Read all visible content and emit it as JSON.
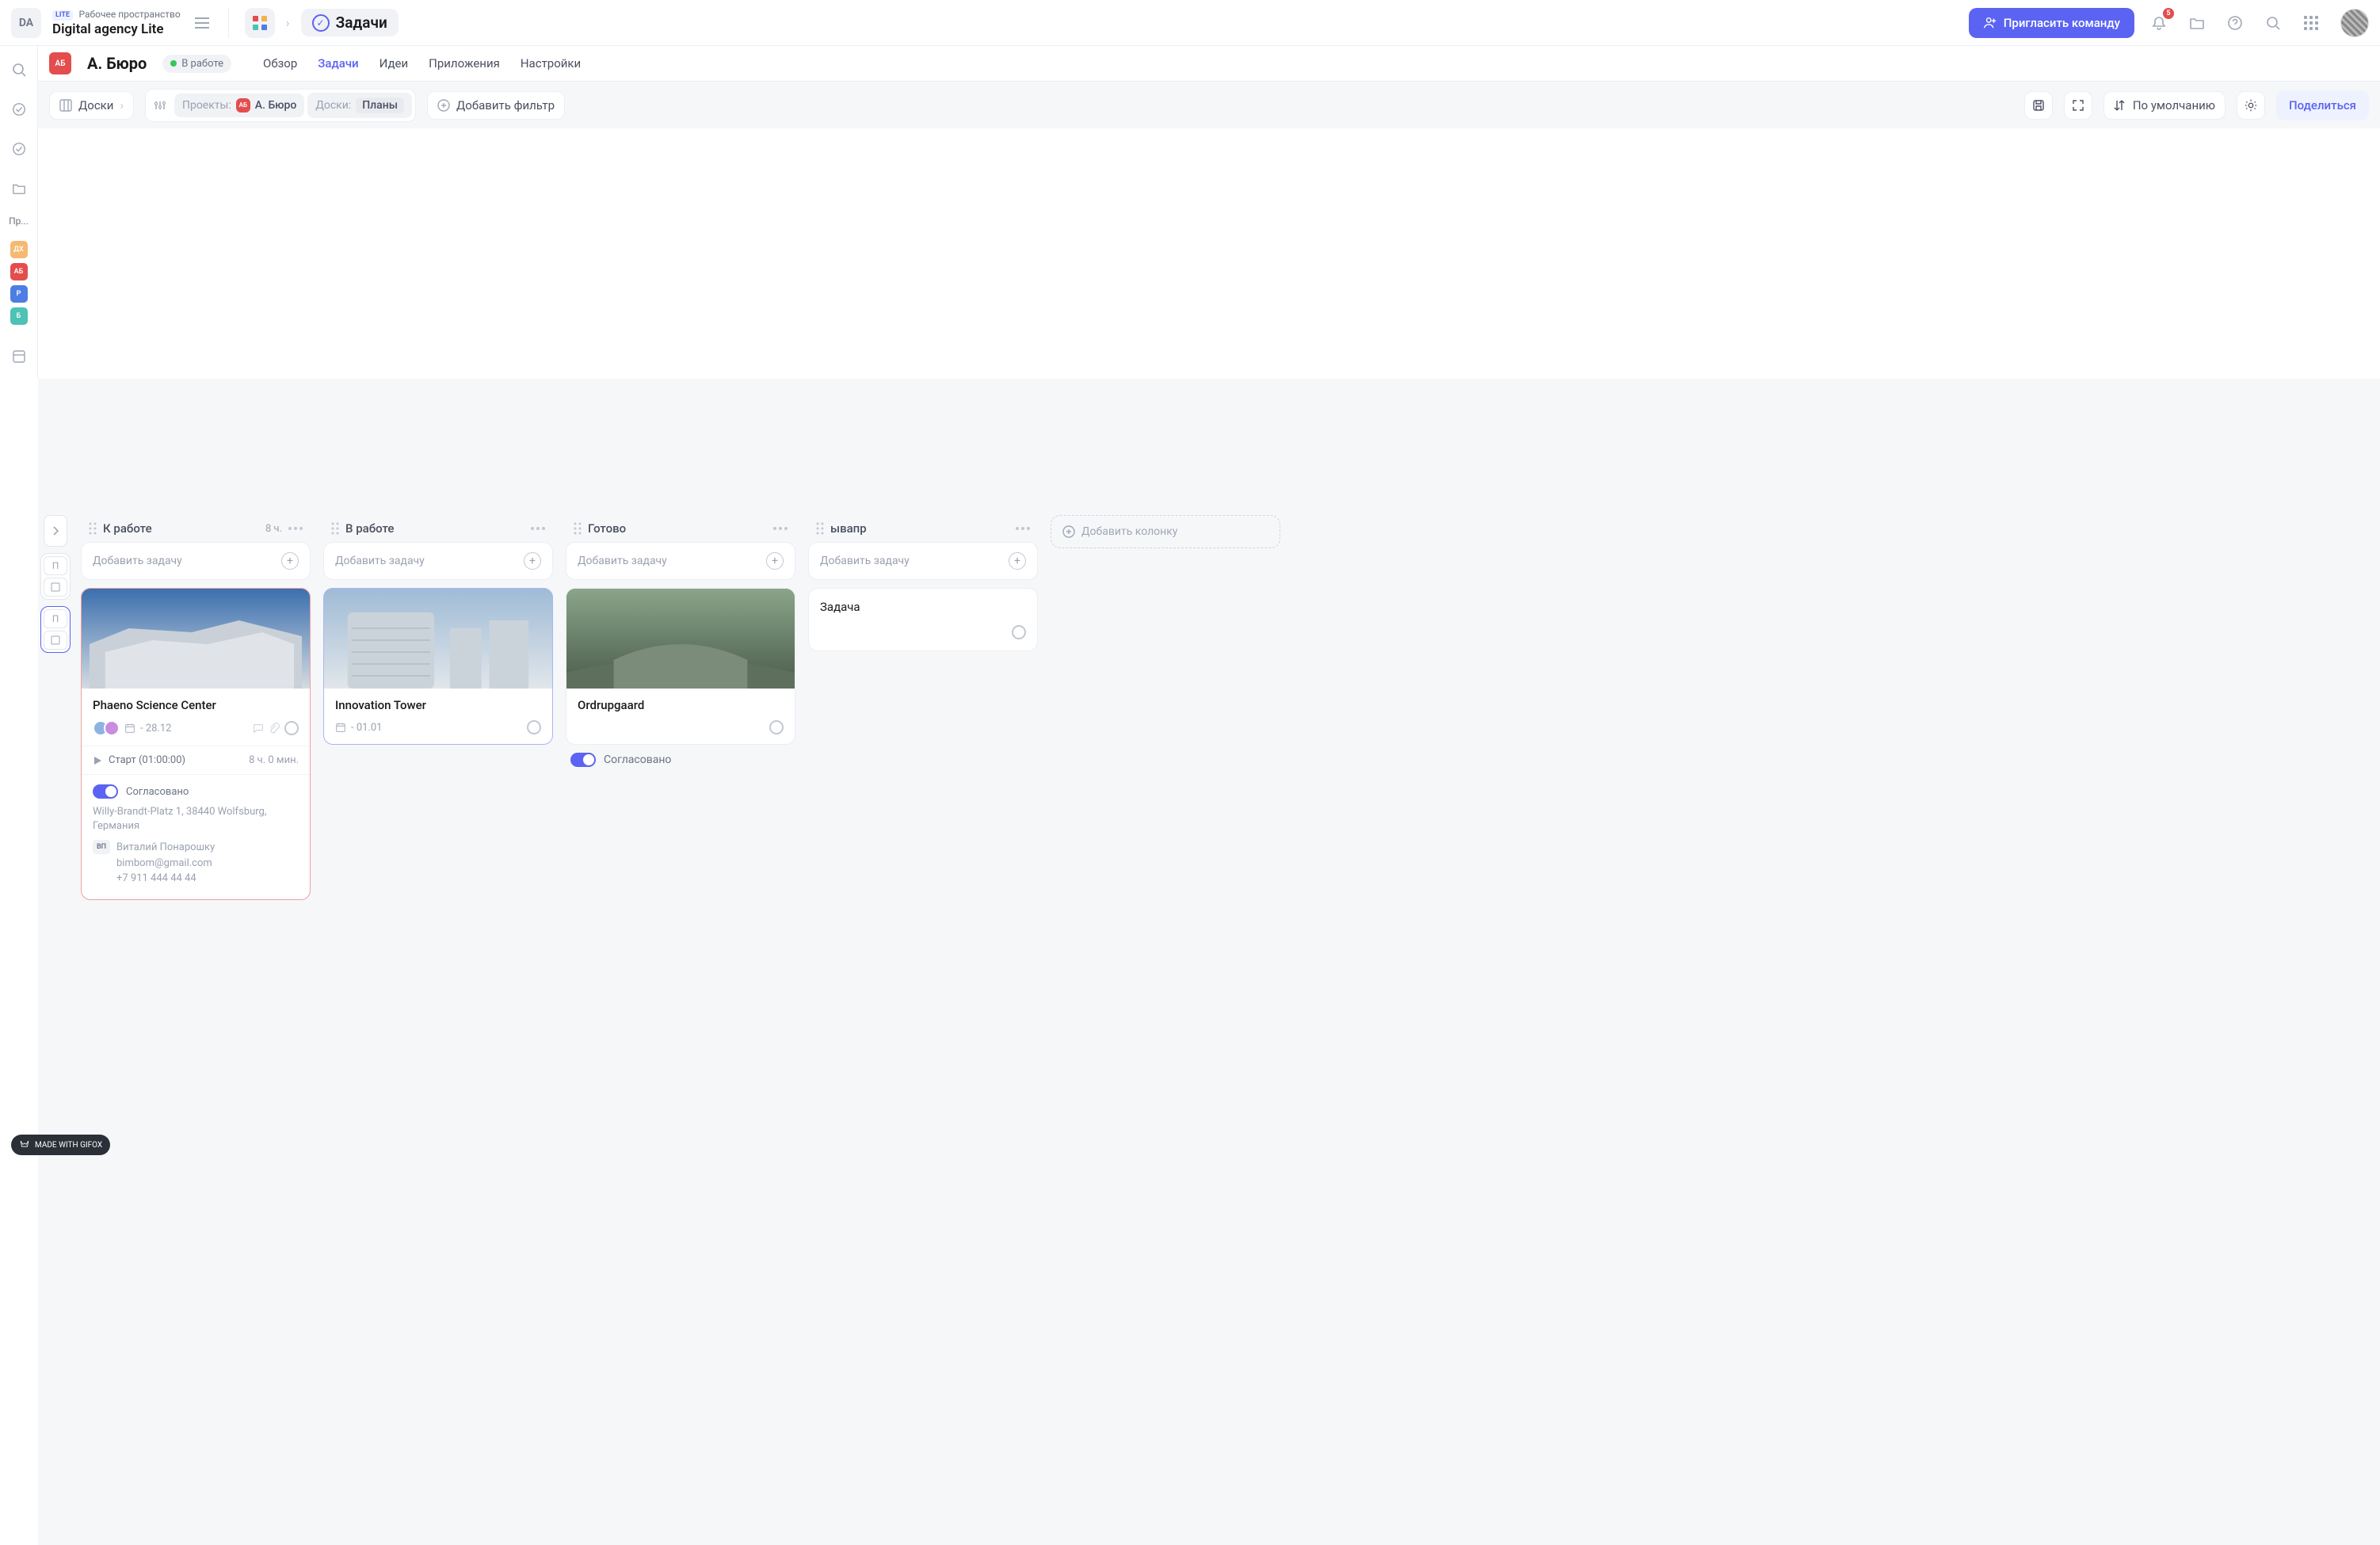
{
  "workspace": {
    "logo_text": "DA",
    "lite_tag": "LITE",
    "label": "Рабочее пространство",
    "name": "Digital agency Lite"
  },
  "breadcrumb": {
    "current": "Задачи"
  },
  "topbar": {
    "invite_label": "Пригласить команду",
    "notif_count": "5"
  },
  "project": {
    "chip": "АБ",
    "name": "А. Бюро",
    "status_label": "В работе",
    "tabs": [
      "Обзор",
      "Задачи",
      "Идеи",
      "Приложения",
      "Настройки"
    ],
    "active_tab": 1
  },
  "toolbar": {
    "boards_label": "Доски",
    "projects_label": "Проекты:",
    "projects_value": "А. Бюро",
    "boards_filter_label": "Доски:",
    "boards_filter_value": "Планы",
    "add_filter_label": "Добавить фильтр",
    "sort_label": "По умолчанию",
    "share_label": "Поделиться"
  },
  "leftbar": {
    "projects_label": "Пр...",
    "badges": [
      {
        "text": "ДХ",
        "cls": "pb-orange"
      },
      {
        "text": "АБ",
        "cls": "pb-red"
      },
      {
        "text": "Р",
        "cls": "pb-blue"
      },
      {
        "text": "Б",
        "cls": "pb-teal"
      }
    ]
  },
  "board_sidebar": {
    "mini_labels": [
      "П",
      "П"
    ]
  },
  "columns": [
    {
      "title": "К работе",
      "meta": "8 ч.",
      "add_task": "Добавить задачу",
      "cards": [
        {
          "kind": "full",
          "border": "red",
          "title": "Phaeno Science Center",
          "date": "- 28.12",
          "start_label": "Старт (01:00:00)",
          "duration": "8 ч. 0 мин.",
          "approved_label": "Согласовано",
          "address": "Willy-Brandt-Platz 1, 38440 Wolfsburg, Германия",
          "contact_badge": "ВП",
          "contact_name": "Виталий Понарошку",
          "contact_email": "bimbom@gmail.com",
          "contact_phone": "+7 911 444 44 44",
          "cover_gradient": "linear-gradient(180deg,#3b6fae 0%, #9fb4c8 50%, #d4dbe2 100%)"
        }
      ]
    },
    {
      "title": "В работе",
      "meta": "",
      "add_task": "Добавить задачу",
      "cards": [
        {
          "kind": "mid",
          "border": "blue",
          "title": "Innovation Tower",
          "date": "- 01.01",
          "cover_gradient": "linear-gradient(180deg,#96b6d4 0%, #c9d4dc 60%, #dfe4e9 100%)"
        }
      ]
    },
    {
      "title": "Готово",
      "meta": "",
      "add_task": "Добавить задачу",
      "cards": [
        {
          "kind": "short",
          "border": "",
          "title": "Ordrupgaard",
          "approved_label": "Согласовано",
          "cover_gradient": "linear-gradient(180deg,#8aa58a 0%, #6d7f6d 50%, #4a5a4a 100%)"
        }
      ]
    },
    {
      "title": "ывапр",
      "meta": "",
      "add_task": "Добавить задачу",
      "cards": [
        {
          "kind": "simple",
          "title": "Задача"
        }
      ]
    }
  ],
  "add_column_label": "Добавить колонку",
  "watermark": "MADE WITH GIFOX"
}
